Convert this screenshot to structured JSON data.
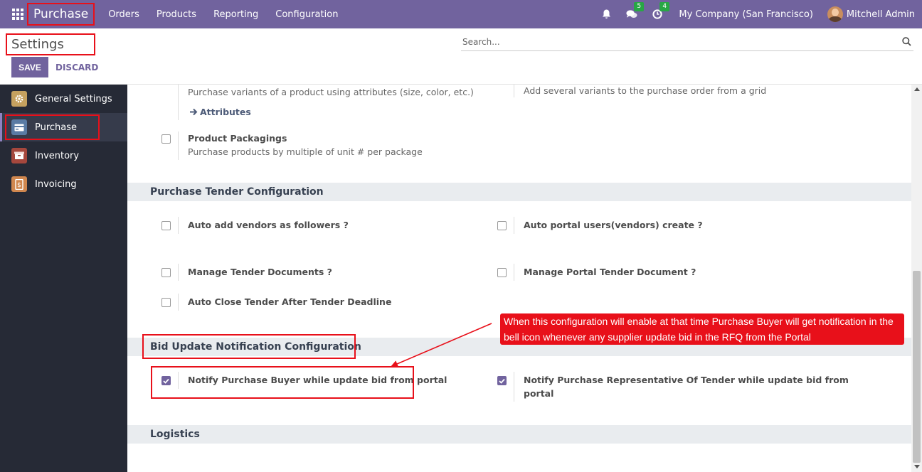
{
  "navbar": {
    "app_name": "Purchase",
    "menu": [
      "Orders",
      "Products",
      "Reporting",
      "Configuration"
    ],
    "messages_badge": "5",
    "activities_badge": "4",
    "company": "My Company (San Francisco)",
    "user": "Mitchell Admin"
  },
  "control": {
    "title": "Settings",
    "save_label": "SAVE",
    "discard_label": "DISCARD",
    "search_placeholder": "Search..."
  },
  "sidebar": {
    "items": [
      {
        "label": "General Settings",
        "icon": "gear-icon",
        "color": "#c5a15f"
      },
      {
        "label": "Purchase",
        "icon": "purchase-card-icon",
        "color": "#5a7ba4"
      },
      {
        "label": "Inventory",
        "icon": "inventory-box-icon",
        "color": "#a5473d"
      },
      {
        "label": "Invoicing",
        "icon": "invoice-dollar-icon",
        "color": "#d0874f"
      }
    ]
  },
  "variants": {
    "desc": "Purchase variants of a product using attributes (size, color, etc.)",
    "link": "Attributes",
    "grid_desc": "Add several variants to the purchase order from a grid"
  },
  "packagings": {
    "label": "Product Packagings",
    "desc": "Purchase products by multiple of unit # per package",
    "checked": false
  },
  "tender": {
    "title": "Purchase Tender Configuration",
    "items": [
      {
        "label": "Auto add vendors as followers ?",
        "checked": false
      },
      {
        "label": "Auto portal users(vendors) create ?",
        "checked": false
      },
      {
        "label": "Manage Tender Documents ?",
        "checked": false
      },
      {
        "label": "Manage Portal Tender Document ?",
        "checked": false
      },
      {
        "label": "Auto Close Tender After Tender Deadline",
        "checked": false
      }
    ]
  },
  "bid": {
    "title": "Bid Update Notification Configuration",
    "items": [
      {
        "label": "Notify Purchase Buyer while update bid from portal",
        "checked": true
      },
      {
        "label_line1": "Notify Purchase Representative Of Tender while update bid from",
        "label_line2": "portal",
        "checked": true
      }
    ]
  },
  "callout": {
    "line1": "When this configuration will enable at that time Purchase Buyer will get notification in the",
    "line2": "bell icon whenever any supplier update bid in the RFQ from the Portal"
  },
  "logistics": {
    "title": "Logistics"
  },
  "colors": {
    "brand": "#71639e",
    "annotation": "#e8101a",
    "sidebar_bg": "#262a36"
  }
}
